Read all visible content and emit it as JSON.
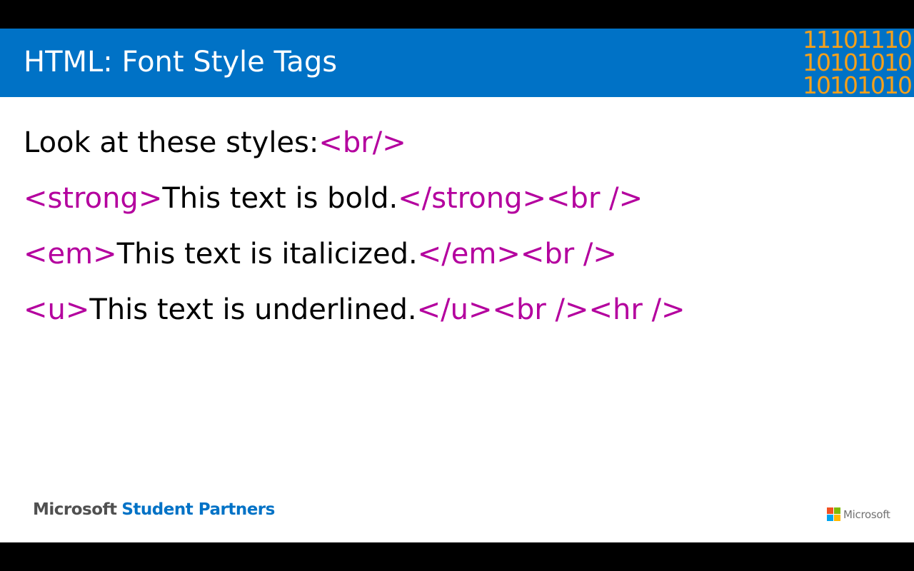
{
  "slide": {
    "title": "HTML: Font Style Tags",
    "binary_decoration": [
      "11101110",
      "10101010",
      "10101010"
    ],
    "lines": [
      [
        {
          "text": "Look at these styles:",
          "kind": "text"
        },
        {
          "text": "<br/>",
          "kind": "tag"
        }
      ],
      [
        {
          "text": "<strong>",
          "kind": "tag"
        },
        {
          "text": "This text is bold.",
          "kind": "text"
        },
        {
          "text": "</strong><br />",
          "kind": "tag"
        }
      ],
      [
        {
          "text": "<em>",
          "kind": "tag"
        },
        {
          "text": "This text is italicized.",
          "kind": "text"
        },
        {
          "text": "</em><br />",
          "kind": "tag"
        }
      ],
      [
        {
          "text": "<u>",
          "kind": "tag"
        },
        {
          "text": "This text is underlined.",
          "kind": "text"
        },
        {
          "text": "</u><br /><hr />",
          "kind": "tag"
        }
      ]
    ]
  },
  "footer": {
    "brand_company": "Microsoft",
    "brand_program": "Student Partners",
    "logo_text": "Microsoft"
  },
  "colors": {
    "title_bar": "#0072c6",
    "tag": "#b4009e",
    "binary": "#f5a01a"
  }
}
